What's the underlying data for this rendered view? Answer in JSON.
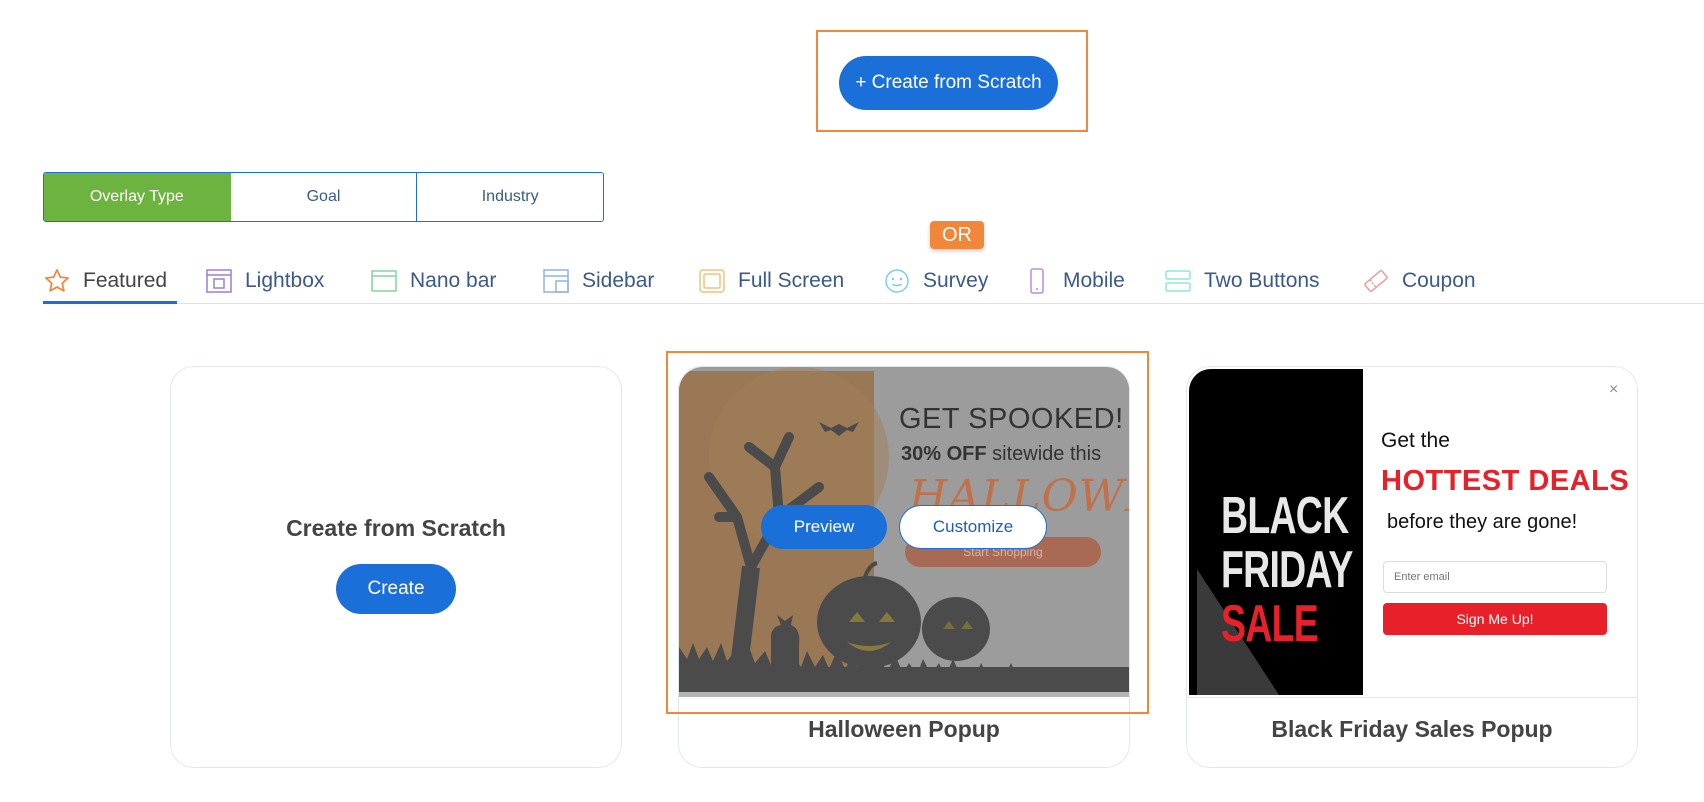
{
  "header": {
    "create_from_scratch_label": "+ Create from Scratch"
  },
  "filters": {
    "segments": [
      {
        "label": "Overlay Type",
        "active": true
      },
      {
        "label": "Goal",
        "active": false
      },
      {
        "label": "Industry",
        "active": false
      }
    ],
    "or_badge": "OR"
  },
  "tabs": [
    {
      "label": "Featured",
      "icon": "star-icon",
      "color": "#f0873a",
      "active": true
    },
    {
      "label": "Lightbox",
      "icon": "lightbox-icon",
      "color": "#9b7fd9"
    },
    {
      "label": "Nano bar",
      "icon": "nano-bar-icon",
      "color": "#7fd99b"
    },
    {
      "label": "Sidebar",
      "icon": "sidebar-icon",
      "color": "#8fb2e8"
    },
    {
      "label": "Full Screen",
      "icon": "full-screen-icon",
      "color": "#f5c07a"
    },
    {
      "label": "Survey",
      "icon": "survey-icon",
      "color": "#7fcde8"
    },
    {
      "label": "Mobile",
      "icon": "mobile-icon",
      "color": "#b28fe8"
    },
    {
      "label": "Two Buttons",
      "icon": "two-buttons-icon",
      "color": "#8fe8d6"
    },
    {
      "label": "Coupon",
      "icon": "coupon-icon",
      "color": "#f29a9a"
    }
  ],
  "cards": {
    "scratch": {
      "title": "Create from Scratch",
      "button": "Create"
    },
    "halloween": {
      "title": "Halloween Popup",
      "preview_button": "Preview",
      "customize_button": "Customize",
      "image": {
        "headline": "GET SPOOKED!",
        "discount_bold": "30% OFF",
        "discount_rest": " sitewide this",
        "script_word": "HALLOWEEN",
        "cta": "Start Shopping"
      }
    },
    "black_friday": {
      "title": "Black Friday Sales Popup",
      "image": {
        "left_line1": "BLACK",
        "left_line2": "FRIDAY",
        "left_line3": "SALE",
        "close": "×",
        "get_the": "Get the",
        "hottest": "HOTTEST DEALS",
        "before": "before they are gone!",
        "email_placeholder": "Enter email",
        "signup": "Sign Me Up!"
      }
    }
  },
  "colors": {
    "primary": "#1a6fd8",
    "active_segment": "#6cb33f",
    "highlight": "#f0873a",
    "sale_red": "#e8202a"
  }
}
